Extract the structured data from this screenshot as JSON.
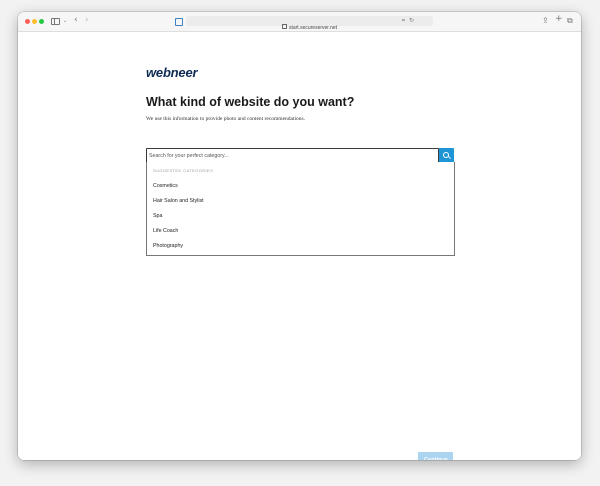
{
  "browser": {
    "url": "start.secureserver.net"
  },
  "page": {
    "logo": "webneer",
    "heading": "What kind of website do you want?",
    "subtitle": "We use this information to provide photo and content recommendations."
  },
  "search": {
    "placeholder": "Search for your perfect category..."
  },
  "suggestions": {
    "header": "SUGGESTED CATEGORIES",
    "items": [
      "Cosmetics",
      "Hair Salon and Stylist",
      "Spa",
      "Life Coach",
      "Photography"
    ]
  },
  "footer": {
    "continue_label": "Continue"
  },
  "colors": {
    "brand": "#0d2c54",
    "accent": "#1e96d6",
    "continue_disabled": "#aad4f0"
  }
}
